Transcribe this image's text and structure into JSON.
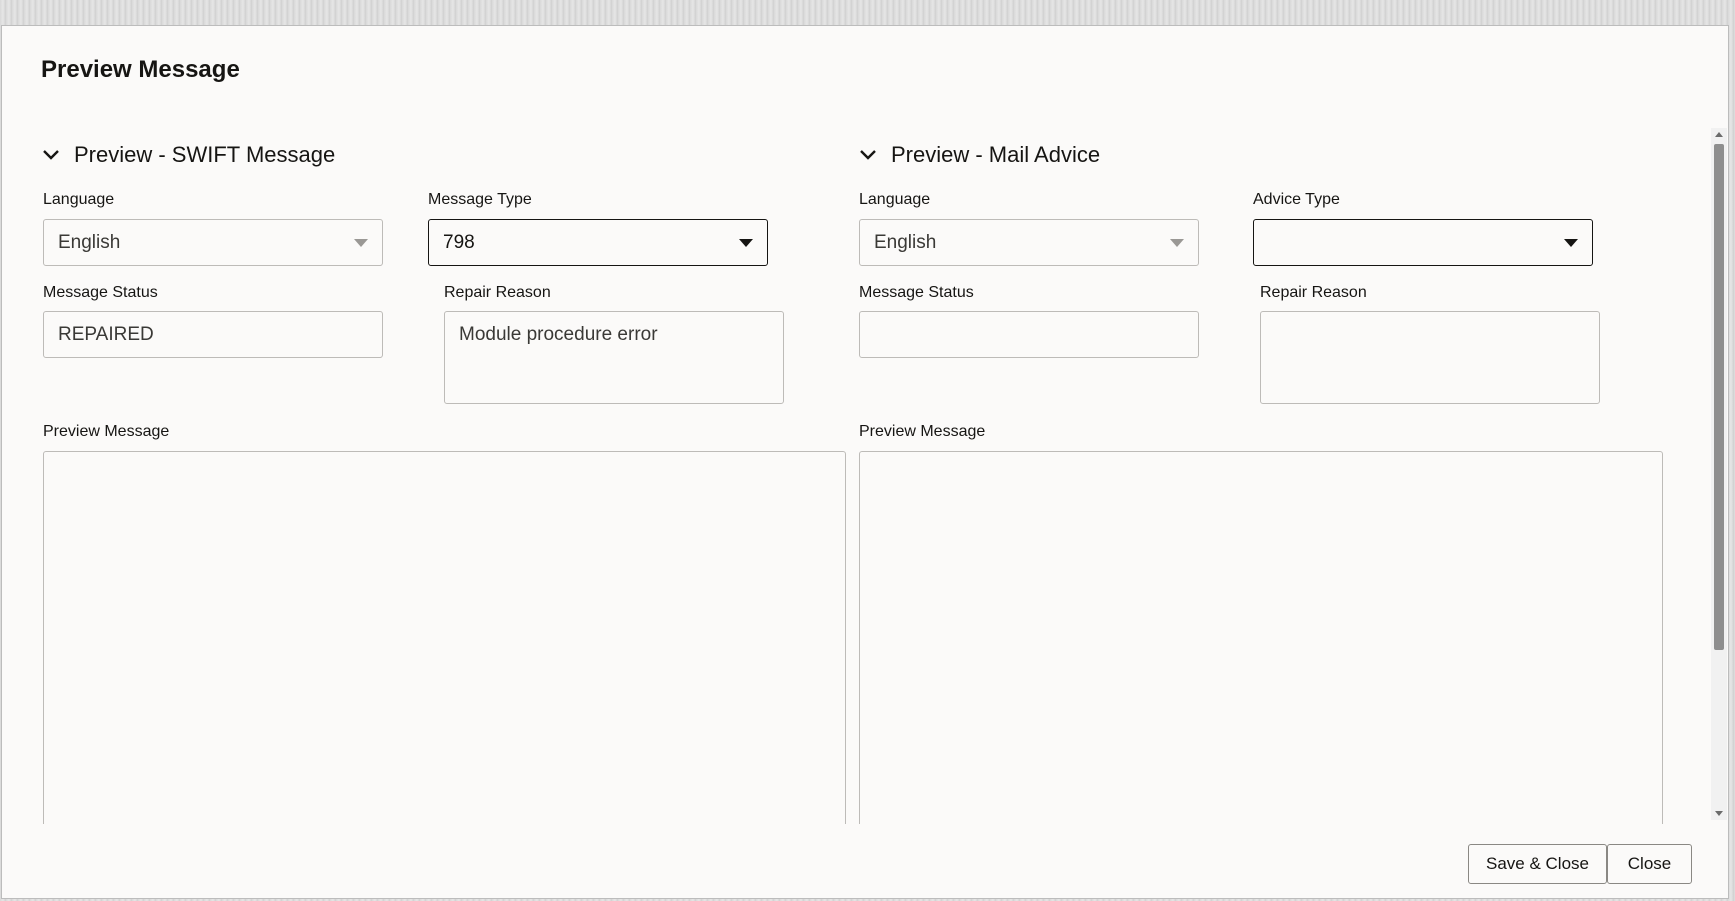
{
  "dialog": {
    "title": "Preview Message"
  },
  "swift": {
    "header": "Preview - SWIFT Message",
    "language_label": "Language",
    "language_value": "English",
    "message_type_label": "Message Type",
    "message_type_value": "798",
    "message_status_label": "Message Status",
    "message_status_value": "REPAIRED",
    "repair_reason_label": "Repair Reason",
    "repair_reason_value": "Module procedure error",
    "preview_label": "Preview Message",
    "preview_value": ""
  },
  "mail": {
    "header": "Preview - Mail Advice",
    "language_label": "Language",
    "language_value": "English",
    "advice_type_label": "Advice Type",
    "advice_type_value": "",
    "message_status_label": "Message Status",
    "message_status_value": "",
    "repair_reason_label": "Repair Reason",
    "repair_reason_value": "",
    "preview_label": "Preview Message",
    "preview_value": ""
  },
  "footer": {
    "save_close_label": "Save & Close",
    "close_label": "Close"
  },
  "icons": {
    "collapse": "chevron-down-icon",
    "dropdown": "caret-down-icon"
  },
  "colors": {
    "dialog_bg": "#fbfaf9",
    "text": "#161513",
    "border": "#bdbbb8"
  }
}
